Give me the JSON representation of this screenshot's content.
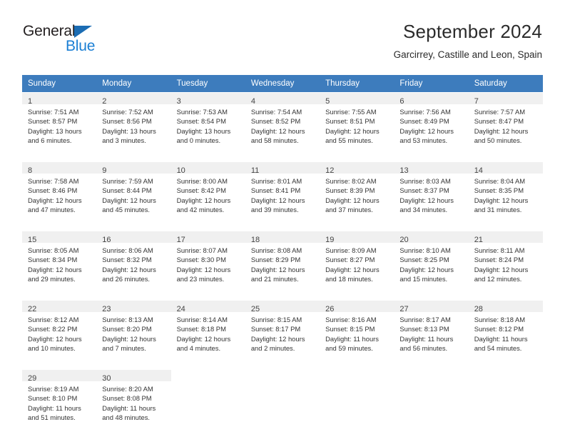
{
  "logo": {
    "word_top": "General",
    "word_bottom": "Blue",
    "triangle_icon": "triangle-icon",
    "color_dark": "#231f20",
    "color_blue": "#1b7fd4"
  },
  "header": {
    "title": "September 2024",
    "subtitle": "Garcirrey, Castille and Leon, Spain"
  },
  "theme": {
    "header_blue": "#3d7cbd",
    "daynum_band": "#f0f0f0",
    "text": "#333333"
  },
  "calendar": {
    "weekday_headers": [
      "Sunday",
      "Monday",
      "Tuesday",
      "Wednesday",
      "Thursday",
      "Friday",
      "Saturday"
    ],
    "weeks": [
      [
        {
          "day": "1",
          "sunrise": "Sunrise: 7:51 AM",
          "sunset": "Sunset: 8:57 PM",
          "daylight1": "Daylight: 13 hours",
          "daylight2": "and 6 minutes."
        },
        {
          "day": "2",
          "sunrise": "Sunrise: 7:52 AM",
          "sunset": "Sunset: 8:56 PM",
          "daylight1": "Daylight: 13 hours",
          "daylight2": "and 3 minutes."
        },
        {
          "day": "3",
          "sunrise": "Sunrise: 7:53 AM",
          "sunset": "Sunset: 8:54 PM",
          "daylight1": "Daylight: 13 hours",
          "daylight2": "and 0 minutes."
        },
        {
          "day": "4",
          "sunrise": "Sunrise: 7:54 AM",
          "sunset": "Sunset: 8:52 PM",
          "daylight1": "Daylight: 12 hours",
          "daylight2": "and 58 minutes."
        },
        {
          "day": "5",
          "sunrise": "Sunrise: 7:55 AM",
          "sunset": "Sunset: 8:51 PM",
          "daylight1": "Daylight: 12 hours",
          "daylight2": "and 55 minutes."
        },
        {
          "day": "6",
          "sunrise": "Sunrise: 7:56 AM",
          "sunset": "Sunset: 8:49 PM",
          "daylight1": "Daylight: 12 hours",
          "daylight2": "and 53 minutes."
        },
        {
          "day": "7",
          "sunrise": "Sunrise: 7:57 AM",
          "sunset": "Sunset: 8:47 PM",
          "daylight1": "Daylight: 12 hours",
          "daylight2": "and 50 minutes."
        }
      ],
      [
        {
          "day": "8",
          "sunrise": "Sunrise: 7:58 AM",
          "sunset": "Sunset: 8:46 PM",
          "daylight1": "Daylight: 12 hours",
          "daylight2": "and 47 minutes."
        },
        {
          "day": "9",
          "sunrise": "Sunrise: 7:59 AM",
          "sunset": "Sunset: 8:44 PM",
          "daylight1": "Daylight: 12 hours",
          "daylight2": "and 45 minutes."
        },
        {
          "day": "10",
          "sunrise": "Sunrise: 8:00 AM",
          "sunset": "Sunset: 8:42 PM",
          "daylight1": "Daylight: 12 hours",
          "daylight2": "and 42 minutes."
        },
        {
          "day": "11",
          "sunrise": "Sunrise: 8:01 AM",
          "sunset": "Sunset: 8:41 PM",
          "daylight1": "Daylight: 12 hours",
          "daylight2": "and 39 minutes."
        },
        {
          "day": "12",
          "sunrise": "Sunrise: 8:02 AM",
          "sunset": "Sunset: 8:39 PM",
          "daylight1": "Daylight: 12 hours",
          "daylight2": "and 37 minutes."
        },
        {
          "day": "13",
          "sunrise": "Sunrise: 8:03 AM",
          "sunset": "Sunset: 8:37 PM",
          "daylight1": "Daylight: 12 hours",
          "daylight2": "and 34 minutes."
        },
        {
          "day": "14",
          "sunrise": "Sunrise: 8:04 AM",
          "sunset": "Sunset: 8:35 PM",
          "daylight1": "Daylight: 12 hours",
          "daylight2": "and 31 minutes."
        }
      ],
      [
        {
          "day": "15",
          "sunrise": "Sunrise: 8:05 AM",
          "sunset": "Sunset: 8:34 PM",
          "daylight1": "Daylight: 12 hours",
          "daylight2": "and 29 minutes."
        },
        {
          "day": "16",
          "sunrise": "Sunrise: 8:06 AM",
          "sunset": "Sunset: 8:32 PM",
          "daylight1": "Daylight: 12 hours",
          "daylight2": "and 26 minutes."
        },
        {
          "day": "17",
          "sunrise": "Sunrise: 8:07 AM",
          "sunset": "Sunset: 8:30 PM",
          "daylight1": "Daylight: 12 hours",
          "daylight2": "and 23 minutes."
        },
        {
          "day": "18",
          "sunrise": "Sunrise: 8:08 AM",
          "sunset": "Sunset: 8:29 PM",
          "daylight1": "Daylight: 12 hours",
          "daylight2": "and 21 minutes."
        },
        {
          "day": "19",
          "sunrise": "Sunrise: 8:09 AM",
          "sunset": "Sunset: 8:27 PM",
          "daylight1": "Daylight: 12 hours",
          "daylight2": "and 18 minutes."
        },
        {
          "day": "20",
          "sunrise": "Sunrise: 8:10 AM",
          "sunset": "Sunset: 8:25 PM",
          "daylight1": "Daylight: 12 hours",
          "daylight2": "and 15 minutes."
        },
        {
          "day": "21",
          "sunrise": "Sunrise: 8:11 AM",
          "sunset": "Sunset: 8:24 PM",
          "daylight1": "Daylight: 12 hours",
          "daylight2": "and 12 minutes."
        }
      ],
      [
        {
          "day": "22",
          "sunrise": "Sunrise: 8:12 AM",
          "sunset": "Sunset: 8:22 PM",
          "daylight1": "Daylight: 12 hours",
          "daylight2": "and 10 minutes."
        },
        {
          "day": "23",
          "sunrise": "Sunrise: 8:13 AM",
          "sunset": "Sunset: 8:20 PM",
          "daylight1": "Daylight: 12 hours",
          "daylight2": "and 7 minutes."
        },
        {
          "day": "24",
          "sunrise": "Sunrise: 8:14 AM",
          "sunset": "Sunset: 8:18 PM",
          "daylight1": "Daylight: 12 hours",
          "daylight2": "and 4 minutes."
        },
        {
          "day": "25",
          "sunrise": "Sunrise: 8:15 AM",
          "sunset": "Sunset: 8:17 PM",
          "daylight1": "Daylight: 12 hours",
          "daylight2": "and 2 minutes."
        },
        {
          "day": "26",
          "sunrise": "Sunrise: 8:16 AM",
          "sunset": "Sunset: 8:15 PM",
          "daylight1": "Daylight: 11 hours",
          "daylight2": "and 59 minutes."
        },
        {
          "day": "27",
          "sunrise": "Sunrise: 8:17 AM",
          "sunset": "Sunset: 8:13 PM",
          "daylight1": "Daylight: 11 hours",
          "daylight2": "and 56 minutes."
        },
        {
          "day": "28",
          "sunrise": "Sunrise: 8:18 AM",
          "sunset": "Sunset: 8:12 PM",
          "daylight1": "Daylight: 11 hours",
          "daylight2": "and 54 minutes."
        }
      ],
      [
        {
          "day": "29",
          "sunrise": "Sunrise: 8:19 AM",
          "sunset": "Sunset: 8:10 PM",
          "daylight1": "Daylight: 11 hours",
          "daylight2": "and 51 minutes."
        },
        {
          "day": "30",
          "sunrise": "Sunrise: 8:20 AM",
          "sunset": "Sunset: 8:08 PM",
          "daylight1": "Daylight: 11 hours",
          "daylight2": "and 48 minutes."
        },
        {
          "day": "",
          "sunrise": "",
          "sunset": "",
          "daylight1": "",
          "daylight2": ""
        },
        {
          "day": "",
          "sunrise": "",
          "sunset": "",
          "daylight1": "",
          "daylight2": ""
        },
        {
          "day": "",
          "sunrise": "",
          "sunset": "",
          "daylight1": "",
          "daylight2": ""
        },
        {
          "day": "",
          "sunrise": "",
          "sunset": "",
          "daylight1": "",
          "daylight2": ""
        },
        {
          "day": "",
          "sunrise": "",
          "sunset": "",
          "daylight1": "",
          "daylight2": ""
        }
      ]
    ]
  }
}
